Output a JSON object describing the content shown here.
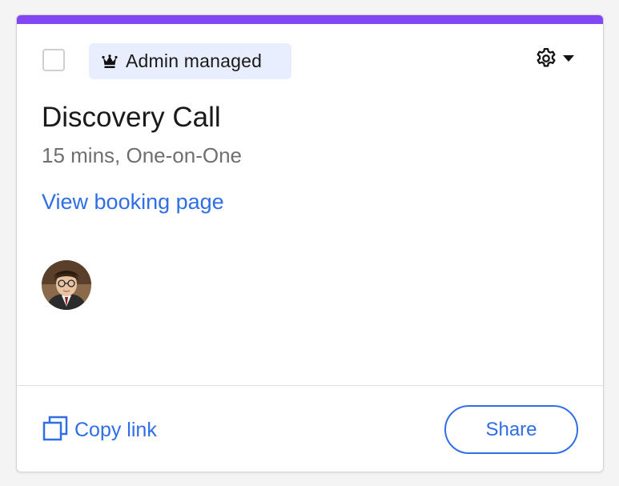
{
  "card": {
    "accent_color": "#8247f5",
    "badge": {
      "icon": "crown-icon",
      "label": "Admin managed"
    },
    "settings": {
      "icon": "gear-icon",
      "dropdown_icon": "caret-down-icon"
    },
    "title": "Discovery Call",
    "subtitle": "15 mins, One-on-One",
    "link_label": "View booking page",
    "avatar": {
      "icon": "user-avatar"
    },
    "footer": {
      "copy_link_label": "Copy link",
      "copy_icon": "copy-icon",
      "share_label": "Share"
    }
  }
}
